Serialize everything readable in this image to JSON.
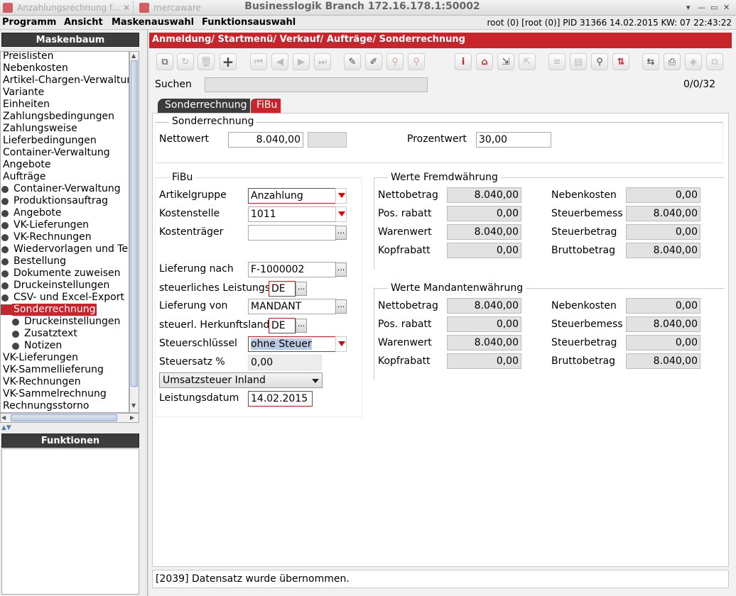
{
  "titlebar": {
    "tab1": "Anzahlungsrechnung f...",
    "tab2": "mercaware",
    "window_title": "Businesslogik Branch 172.16.178.1:50002",
    "btn_min": "▾",
    "btn_max": "—",
    "btn_restore": "▭",
    "btn_close": "✕"
  },
  "menubar": {
    "items": [
      "Programm",
      "Ansicht",
      "Maskenauswahl",
      "Funktionsauswahl"
    ],
    "info": "root (0) [root (0)] PID 31366  14.02.2015 KW: 07  22:43:22"
  },
  "left": {
    "tree_header": "Maskenbaum",
    "func_header": "Funktionen",
    "tree_items": [
      {
        "label": "Preislisten"
      },
      {
        "label": "Nebenkosten"
      },
      {
        "label": "Artikel-Chargen-Verwaltung"
      },
      {
        "label": "Variante"
      },
      {
        "label": "Einheiten"
      },
      {
        "label": "Zahlungsbedingungen"
      },
      {
        "label": "Zahlungsweise"
      },
      {
        "label": "Lieferbedingungen"
      },
      {
        "label": "Container-Verwaltung"
      },
      {
        "label": "Angebote"
      },
      {
        "label": "Aufträge"
      },
      {
        "label": "Container-Verwaltung"
      },
      {
        "label": "Produktionsauftrag"
      },
      {
        "label": "Angebote"
      },
      {
        "label": "VK-Lieferungen"
      },
      {
        "label": "VK-Rechnungen"
      },
      {
        "label": "Wiedervorlagen und Termine"
      },
      {
        "label": "Bestellung"
      },
      {
        "label": "Dokumente zuweisen"
      },
      {
        "label": "Druckeinstellungen"
      },
      {
        "label": "CSV- und Excel-Export"
      },
      {
        "label": "Sonderrechnung"
      },
      {
        "label": "Druckeinstellungen"
      },
      {
        "label": "Zusatztext"
      },
      {
        "label": "Notizen"
      },
      {
        "label": "VK-Lieferungen"
      },
      {
        "label": "VK-Sammellieferung"
      },
      {
        "label": "VK-Rechnungen"
      },
      {
        "label": "VK-Sammelrechnung"
      },
      {
        "label": "Rechnungsstorno"
      }
    ]
  },
  "breadcrumb": "Anmeldung/ Startmenü/ Verkauf/ Aufträge/ Sonderrechnung",
  "toolbar": {
    "icons": [
      "copy-icon",
      "refresh-icon",
      "delete-icon",
      "add-icon",
      "first-icon",
      "prev-icon",
      "next-icon",
      "last-icon",
      "edit-icon",
      "pin-icon",
      "link-icon",
      "unlink-icon",
      "info-icon",
      "home-icon",
      "export-icon",
      "import-icon",
      "list-icon",
      "table-icon",
      "search-icon",
      "sort-icon",
      "switch-icon",
      "print-icon",
      "tag-icon",
      "copy-doc-icon"
    ],
    "glyphs": {
      "copy": "⧉",
      "refresh": "↻",
      "delete": "🗑",
      "add": "+",
      "first": "⏮",
      "prev": "◀",
      "next": "▶",
      "last": "⏭",
      "edit": "✎",
      "pin": "✐",
      "link": "⚲",
      "unlink": "⚲",
      "info": "i",
      "home": "⌂",
      "export": "⇲",
      "import": "⇱",
      "list": "≡",
      "table": "▤",
      "search": "⚲",
      "sort": "⇅",
      "switch": "⇆",
      "print": "⎙",
      "tag": "◈",
      "copy_doc": "⧉"
    }
  },
  "search": {
    "label": "Suchen",
    "value": "",
    "counter": "0/0/32"
  },
  "form_tabs": {
    "tab1": "Sonderrechnung",
    "tab2": "FiBu"
  },
  "sonderrechnung": {
    "title": "Sonderrechnung",
    "nettowert_label": "Nettowert",
    "nettowert": "8.040,00",
    "extra": "",
    "prozentwert_label": "Prozentwert",
    "prozentwert": "30,00"
  },
  "fibu": {
    "title": "FiBu",
    "artikelgruppe_label": "Artikelgruppe",
    "artikelgruppe": "Anzahlung",
    "kostenstelle_label": "Kostenstelle",
    "kostenstelle": "1011",
    "kostentraeger_label": "Kostenträger",
    "kostentraeger": "",
    "lieferung_nach_label": "Lieferung nach",
    "lieferung_nach": "F-1000002",
    "leistungsort_label": "steuerliches Leistungsort",
    "leistungsort": "DE",
    "lieferung_von_label": "Lieferung von",
    "lieferung_von": "MANDANT",
    "herkunftsland_label": "steuerl. Herkunftsland",
    "herkunftsland": "DE",
    "steuerschluessel_label": "Steuerschlüssel",
    "steuerschluessel": "ohne Steuer",
    "steuersatz_label": "Steuersatz %",
    "steuersatz": "0,00",
    "umsatzsteuer": "Umsatzsteuer Inland",
    "leistungsdatum_label": "Leistungsdatum",
    "leistungsdatum": "14.02.2015"
  },
  "fremd": {
    "title": "Werte Fremdwährung",
    "nettobetrag_label": "Nettobetrag",
    "nettobetrag": "8.040,00",
    "posrabatt_label": "Pos. rabatt",
    "posrabatt": "0,00",
    "warenwert_label": "Warenwert",
    "warenwert": "8.040,00",
    "kopfrabatt_label": "Kopfrabatt",
    "kopfrabatt": "0,00",
    "nebenkosten_label": "Nebenkosten",
    "nebenkosten": "0,00",
    "steuerbemess_label": "Steuerbemess",
    "steuerbemess": "8.040,00",
    "steuerbetrag_label": "Steuerbetrag",
    "steuerbetrag": "0,00",
    "bruttobetrag_label": "Bruttobetrag",
    "bruttobetrag": "8.040,00"
  },
  "mandant": {
    "title": "Werte Mandantenwährung",
    "nettobetrag_label": "Nettobetrag",
    "nettobetrag": "8.040,00",
    "posrabatt_label": "Pos. rabatt",
    "posrabatt": "0,00",
    "warenwert_label": "Warenwert",
    "warenwert": "8.040,00",
    "kopfrabatt_label": "Kopfrabatt",
    "kopfrabatt": "0,00",
    "nebenkosten_label": "Nebenkosten",
    "nebenkosten": "0,00",
    "steuerbemess_label": "Steuerbemess",
    "steuerbemess": "8.040,00",
    "steuerbetrag_label": "Steuerbetrag",
    "steuerbetrag": "0,00",
    "bruttobetrag_label": "Bruttobetrag",
    "bruttobetrag": "8.040,00"
  },
  "statusbar": "[2039] Datensatz wurde übernommen.",
  "colors": {
    "accent": "#c8242b",
    "header": "#3c3c3c"
  }
}
